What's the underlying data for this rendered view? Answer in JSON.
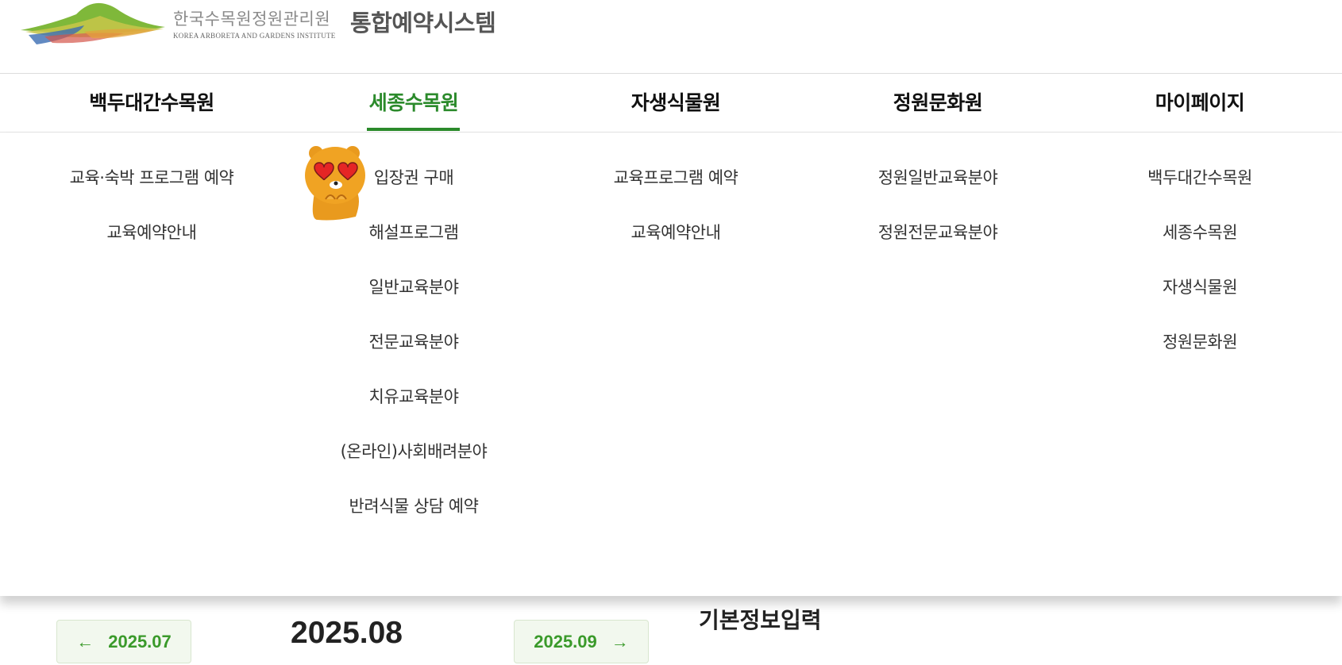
{
  "header": {
    "logo_korean": "한국수목원정원관리원",
    "logo_english": "KOREA ARBORETA AND GARDENS INSTITUTE",
    "system_title": "통합예약시스템"
  },
  "nav": {
    "items": [
      {
        "label": "백두대간수목원"
      },
      {
        "label": "세종수목원"
      },
      {
        "label": "자생식물원"
      },
      {
        "label": "정원문화원"
      },
      {
        "label": "마이페이지"
      }
    ],
    "active_index": 1,
    "active_color": "#2b8a2b"
  },
  "dropdown": {
    "columns": [
      {
        "items": [
          "교육·숙박 프로그램 예약",
          "교육예약안내"
        ]
      },
      {
        "items": [
          "입장권 구매",
          "해설프로그램",
          "일반교육분야",
          "전문교육분야",
          "치유교육분야",
          "(온라인)사회배려분야",
          "반려식물 상담 예약"
        ]
      },
      {
        "items": [
          "교육프로그램 예약",
          "교육예약안내"
        ]
      },
      {
        "items": [
          "정원일반교육분야",
          "정원전문교육분야"
        ]
      },
      {
        "items": [
          "백두대간수목원",
          "세종수목원",
          "자생식물원",
          "정원문화원"
        ]
      }
    ]
  },
  "calendar": {
    "prev_label": "2025.07",
    "prev_arrow": "←",
    "current_month": "2025.08",
    "next_label": "2025.09",
    "next_arrow": "→",
    "section_title": "기본정보입력",
    "accent_color": "#3a9a2a"
  }
}
